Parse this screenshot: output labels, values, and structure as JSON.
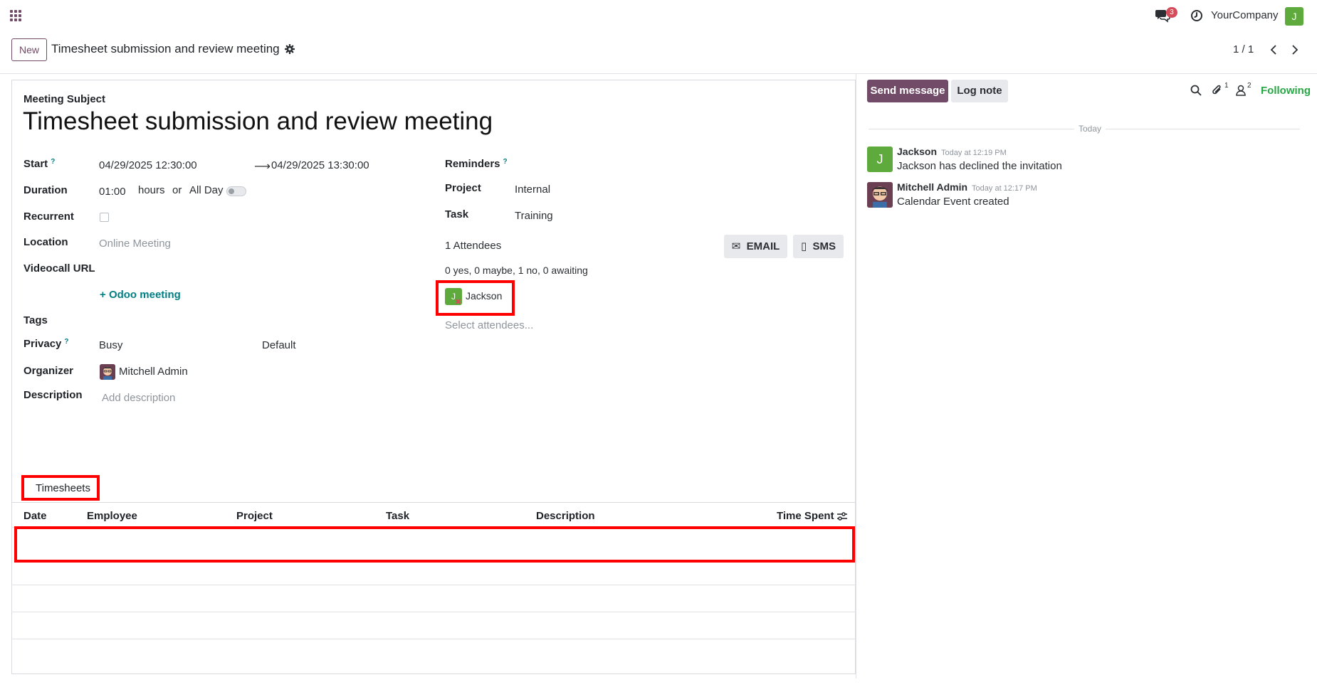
{
  "topbar": {
    "apps_icon": "apps-grid-icon",
    "notification_count": "3",
    "company": "YourCompany",
    "user_initial": "J"
  },
  "control_panel": {
    "new_label": "New",
    "breadcrumb": "Timesheet submission and review meeting",
    "pager": "1 / 1"
  },
  "form": {
    "subject_label": "Meeting Subject",
    "title": "Timesheet submission and review meeting",
    "help_mark": "?",
    "start_label": "Start",
    "start_value": "04/29/2025 12:30:00",
    "end_value": "04/29/2025 13:30:00",
    "duration_label": "Duration",
    "duration_value": "01:00",
    "hours_text": "hours",
    "or_text": "or",
    "allday_text": "All Day",
    "recurrent_label": "Recurrent",
    "location_label": "Location",
    "location_value": "Online Meeting",
    "videocall_label": "Videocall URL",
    "odoo_meeting_link": "Odoo meeting",
    "tags_label": "Tags",
    "privacy_label": "Privacy",
    "privacy_value": "Busy",
    "privacy_default": "Default",
    "organizer_label": "Organizer",
    "organizer_value": "Mitchell Admin",
    "description_label": "Description",
    "description_placeholder": "Add description",
    "reminders_label": "Reminders",
    "project_label": "Project",
    "project_value": "Internal",
    "task_label": "Task",
    "task_value": "Training",
    "attendees_count": "1 Attendees",
    "email_label": "EMAIL",
    "sms_label": "SMS",
    "attendee_summary": "0 yes, 0 maybe, 1 no, 0 awaiting",
    "attendee_initial": "J",
    "attendee_name": "Jackson",
    "select_attendees_placeholder": "Select attendees..."
  },
  "timesheets": {
    "tab_label": "Timesheets",
    "columns": [
      "Date",
      "Employee",
      "Project",
      "Task",
      "Description",
      "Time Spent"
    ]
  },
  "chatter": {
    "send_message": "Send message",
    "log_note": "Log note",
    "attachments_count": "1",
    "followers_count": "2",
    "following": "Following",
    "today": "Today",
    "messages": [
      {
        "author": "Jackson",
        "initial": "J",
        "time": "Today at 12:19 PM",
        "body": "Jackson has declined the invitation"
      },
      {
        "author": "Mitchell Admin",
        "time": "Today at 12:17 PM",
        "body": "Calendar Event created"
      }
    ]
  },
  "colors": {
    "brand": "#714b67",
    "link": "#017e84",
    "following": "#28a745",
    "highlight": "#ff0000",
    "badge": "#d44c59"
  }
}
